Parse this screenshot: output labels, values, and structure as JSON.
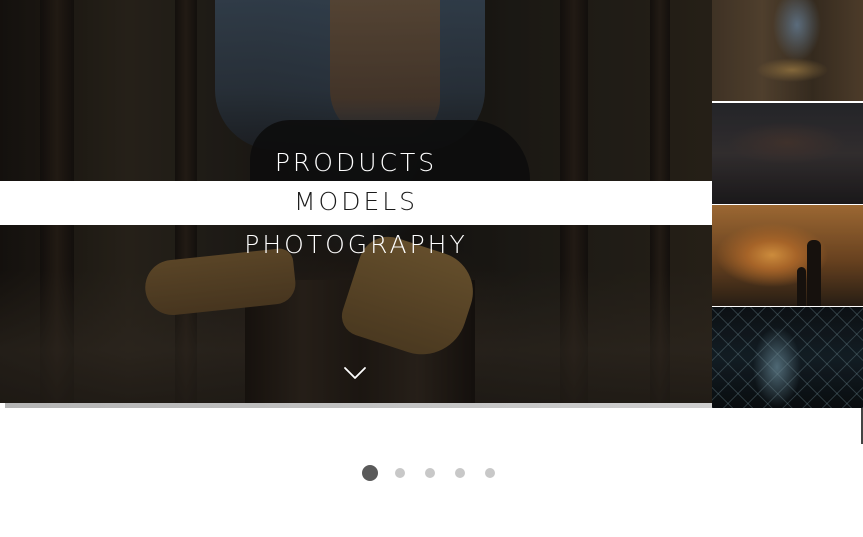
{
  "menu": {
    "items": [
      {
        "label": "PRODUCTS"
      },
      {
        "label": "MODELS"
      },
      {
        "label": "PHOTOGRAPHY"
      }
    ],
    "active_index": 1
  },
  "hero": {
    "scroll_icon": "chevron-down-icon"
  },
  "thumbnails": [
    {
      "subject": "woman-sitting-on-stump"
    },
    {
      "subject": "people-lying-on-car"
    },
    {
      "subject": "sunset-father-and-child"
    },
    {
      "subject": "chain-link-fence-night"
    }
  ],
  "pagination": {
    "count": 5,
    "active": 1
  },
  "colors": {
    "menu_text": "#ffffff",
    "menu_active_bg": "#ffffff",
    "menu_active_text": "#1a1a1a",
    "dot_active": "#5a5a5a",
    "dot_inactive": "#c8c8c8"
  }
}
